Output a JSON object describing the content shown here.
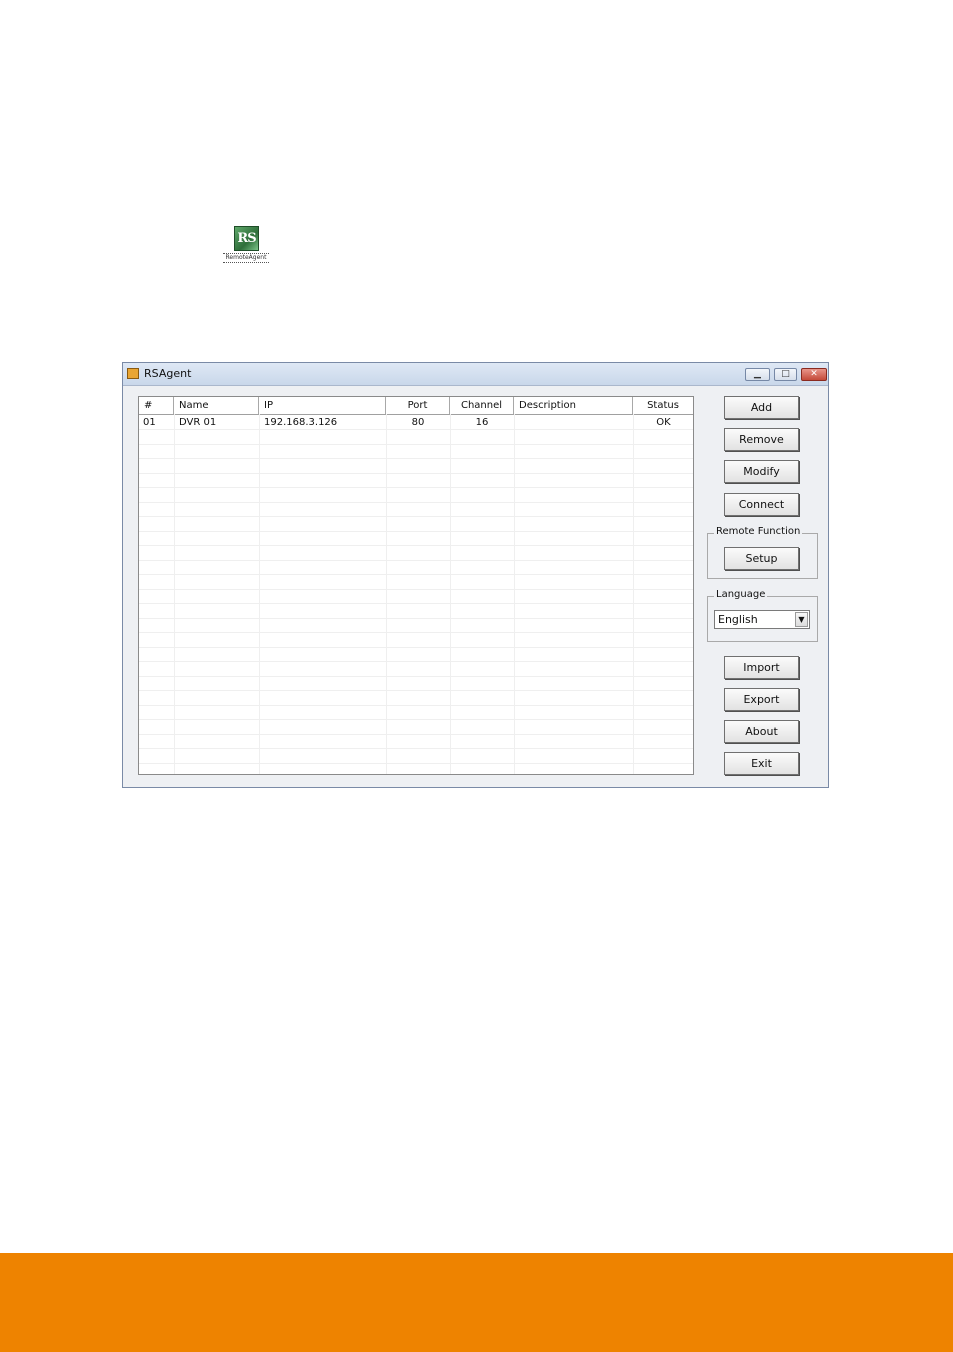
{
  "desktop_icon": {
    "glyph": "RS",
    "caption": "RemoteAgent",
    "icon": "rsagent-app-icon"
  },
  "window": {
    "title": "RSAgent",
    "app_icon": "rsagent-window-icon",
    "controls": {
      "minimize": "▁",
      "maximize": "□",
      "close": "✕"
    }
  },
  "list": {
    "columns": [
      "#",
      "Name",
      "IP",
      "Port",
      "Channel",
      "Description",
      "Status"
    ],
    "rows": [
      {
        "num": "01",
        "name": "DVR 01",
        "ip": "192.168.3.126",
        "port": "80",
        "channel": "16",
        "description": "",
        "status": "OK"
      }
    ]
  },
  "buttons": {
    "add": "Add",
    "remove": "Remove",
    "modify": "Modify",
    "connect": "Connect",
    "setup": "Setup",
    "import": "Import",
    "export": "Export",
    "about": "About",
    "exit": "Exit"
  },
  "remote_function": {
    "label": "Remote Function"
  },
  "language": {
    "label": "Language",
    "selected": "English",
    "arrow_icon": "dropdown-arrow-icon"
  },
  "colors": {
    "footer": "#ee8300",
    "titlebar": "#c9d7ea"
  }
}
